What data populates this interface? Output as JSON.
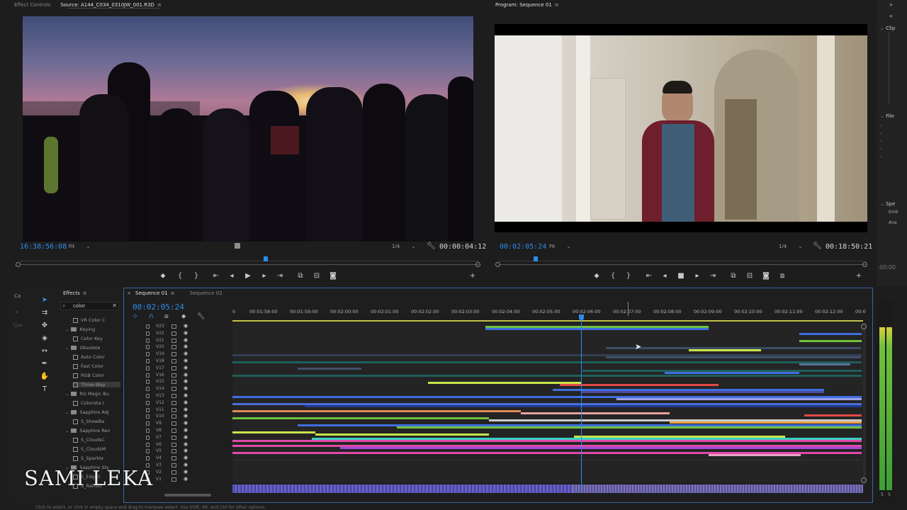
{
  "source_monitor": {
    "tabs": [
      "Effect Controls",
      "Source: A144_C034_0310JW_001.R3D"
    ],
    "timecode": "16:38:56:08",
    "zoom": "Fit",
    "resolution": "1/4",
    "duration": "00:00:04:12"
  },
  "program_monitor": {
    "tab": "Program: Sequence 01",
    "timecode": "00:02:05:24",
    "zoom": "Fit",
    "resolution": "1/4",
    "duration": "00:18:50:21"
  },
  "right_panel": {
    "sections": [
      "Clip",
      "File",
      "Spe"
    ],
    "sub_items": [
      "Emb",
      "Ana"
    ],
    "timecode": "00:00"
  },
  "effects": {
    "tab": "Effects",
    "search_value": "color",
    "items": [
      {
        "label": "VR Color C",
        "depth": 2,
        "kind": "effect"
      },
      {
        "label": "Keying",
        "depth": 1,
        "kind": "folder"
      },
      {
        "label": "Color Key",
        "depth": 2,
        "kind": "effect"
      },
      {
        "label": "Obsolete",
        "depth": 1,
        "kind": "folder"
      },
      {
        "label": "Auto Color",
        "depth": 2,
        "kind": "effect"
      },
      {
        "label": "Fast Color",
        "depth": 2,
        "kind": "effect"
      },
      {
        "label": "RGB Color",
        "depth": 2,
        "kind": "effect"
      },
      {
        "label": "Three-Way",
        "depth": 2,
        "kind": "effect",
        "selected": true
      },
      {
        "label": "RG Magic Bu",
        "depth": 1,
        "kind": "folder"
      },
      {
        "label": "Colorista I",
        "depth": 2,
        "kind": "effect"
      },
      {
        "label": "Sapphire Adj",
        "depth": 1,
        "kind": "folder"
      },
      {
        "label": "S_ShowBa",
        "depth": 2,
        "kind": "effect"
      },
      {
        "label": "Sapphire Ren",
        "depth": 1,
        "kind": "folder"
      },
      {
        "label": "S_CloudsC",
        "depth": 2,
        "kind": "effect"
      },
      {
        "label": "S_CloudsM",
        "depth": 2,
        "kind": "effect"
      },
      {
        "label": "S_Sparkle",
        "depth": 2,
        "kind": "effect"
      },
      {
        "label": "Sapphire Sty",
        "depth": 1,
        "kind": "folder"
      },
      {
        "label": "S_EdgeC",
        "depth": 2,
        "kind": "effect"
      },
      {
        "label": "S_Rainbo",
        "depth": 2,
        "kind": "effect"
      }
    ]
  },
  "left_stub": {
    "tab": "Ca",
    "label": "Type"
  },
  "timeline": {
    "tabs": [
      "Sequence 01",
      "Sequence 02"
    ],
    "timecode": "00:02:05:24",
    "ruler_labels": [
      "0",
      "00:01:58:00",
      "00:01:59:00",
      "00:02:00:00",
      "00:02:01:00",
      "00:02:02:00",
      "00:02:03:00",
      "00:02:04:00",
      "00:02:05:00",
      "00:02:06:00",
      "00:02:07:00",
      "00:02:08:00",
      "00:02:09:00",
      "00:02:10:00",
      "00:02:11:00",
      "00:02:12:00",
      "00:0"
    ],
    "tracks": [
      "V23",
      "V22",
      "V21",
      "V20",
      "V19",
      "V18",
      "V17",
      "V16",
      "V15",
      "V14",
      "V13",
      "V12",
      "V11",
      "V10",
      "V9",
      "V8",
      "V7",
      "V6",
      "V5",
      "V4",
      "V3",
      "V2",
      "V1"
    ],
    "audio_meter_labels": [
      "S",
      "S"
    ]
  },
  "watermark": "SAMI LEKA",
  "status_bar": "Click to select, or click in empty space and drag to marquee select. Use Shift, Alt, and Ctrl for other options."
}
